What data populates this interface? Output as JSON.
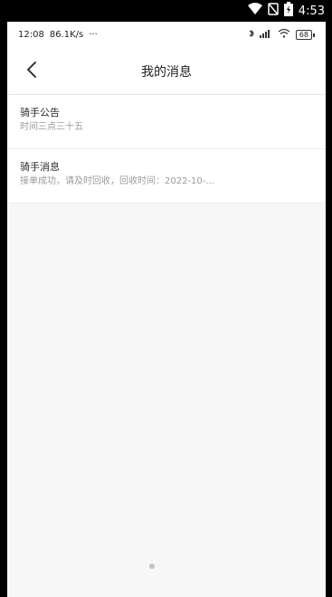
{
  "device_status": {
    "time": "4:53"
  },
  "inner_status": {
    "time": "12:08",
    "net_speed": "86.1K/s",
    "more": "···",
    "battery": "68"
  },
  "header": {
    "title": "我的消息"
  },
  "messages": [
    {
      "title": "骑手公告",
      "subtitle": "时间三点三十五"
    },
    {
      "title": "骑手消息",
      "subtitle": "接单成功，请及时回收，回收时间：2022-10-..."
    }
  ],
  "icons": {
    "wifi": "wifi-icon",
    "no_sim": "no-sim-icon",
    "battery": "battery-charging-icon",
    "bluetooth": "bluetooth-icon",
    "signal": "signal-icon",
    "back": "back-arrow-icon"
  }
}
